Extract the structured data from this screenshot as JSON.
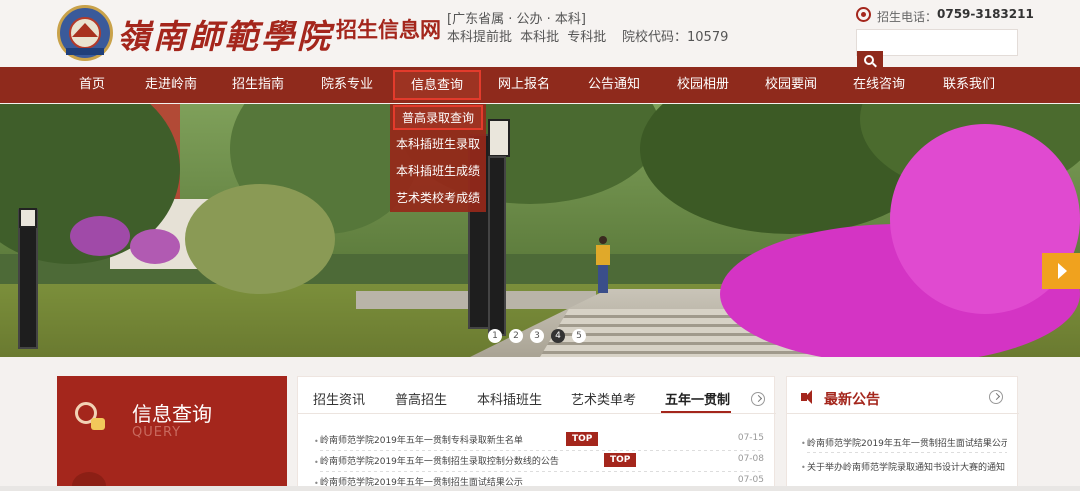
{
  "header": {
    "brand_calligraphy": "嶺南師範學院",
    "brand_subtitle": "招生信息网",
    "tag_line1": "[广东省属 · 公办 · 本科]",
    "tag_line2": "本科提前批 本科批 专科批",
    "code_label": "院校代码：10579",
    "phone_label": "招生电话：",
    "phone_number": "0759-3183211",
    "search_placeholder": ""
  },
  "nav": {
    "items": [
      "首页",
      "走进岭南",
      "招生指南",
      "院系专业",
      "信息查询",
      "网上报名",
      "公告通知",
      "校园相册",
      "校园要闻",
      "在线咨询",
      "联系我们"
    ],
    "active": "信息查询"
  },
  "dropdown": {
    "items": [
      "普高录取查询",
      "本科插班生录取",
      "本科插班生成绩",
      "艺术类校考成绩"
    ],
    "highlighted": "普高录取查询"
  },
  "banner": {
    "pager": [
      "1",
      "2",
      "3",
      "4",
      "5"
    ],
    "current_page": "4"
  },
  "query_panel": {
    "title": "信息查询",
    "subtitle": "QUERY"
  },
  "news": {
    "tabs": [
      "招生资讯",
      "普高招生",
      "本科插班生",
      "艺术类单考",
      "五年一贯制"
    ],
    "active_tab": "五年一贯制",
    "rows": [
      {
        "title": "岭南师范学院2019年五年一贯制专科录取新生名单",
        "date": "07-15",
        "badge": "TOP"
      },
      {
        "title": "岭南师范学院2019年五年一贯制招生录取控制分数线的公告",
        "date": "07-08",
        "badge": "TOP"
      },
      {
        "title": "岭南师范学院2019年五年一贯制招生面试结果公示",
        "date": "07-05",
        "badge": ""
      }
    ]
  },
  "notice": {
    "title": "最新公告",
    "rows": [
      "岭南师范学院2019年五年一贯制招生面试结果公示",
      "关于举办岭南师范学院录取通知书设计大赛的通知"
    ]
  },
  "colors": {
    "brand_red": "#a4261c",
    "nav_bg": "#8f2a1c",
    "highlight_border": "#e33b2c",
    "arrow_orange": "#f0a21e"
  }
}
